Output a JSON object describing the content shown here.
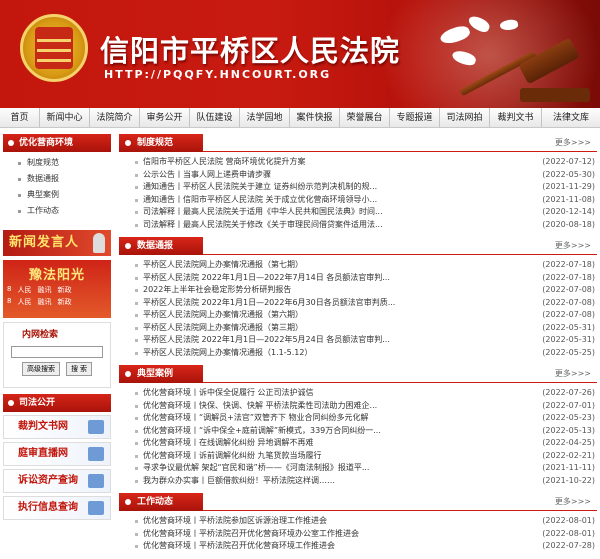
{
  "site": {
    "title": "信阳市平桥区人民法院",
    "url": "HTTP://PQQFY.HNCOURT.ORG"
  },
  "nav": [
    "首页",
    "新闻中心",
    "法院简介",
    "审务公开",
    "队伍建设",
    "法学园地",
    "案件快报",
    "荣誉展台",
    "专题报道",
    "司法网拍",
    "裁判文书",
    "法律文库"
  ],
  "sidebar": {
    "env_title": "优化营商环境",
    "env_items": [
      "制度规范",
      "数据通报",
      "典型案例",
      "工作动态"
    ],
    "ad1": "新闻发言人",
    "ad2": {
      "title": "豫法阳光",
      "row1": [
        "8",
        "人民",
        "融讯",
        "新政"
      ],
      "row2": [
        "8",
        "人民",
        "融讯",
        "新政"
      ]
    },
    "search": {
      "title": "内网检索",
      "advanced": "高级搜索",
      "submit": "搜 索"
    },
    "open_title": "司法公开",
    "quick": [
      "裁判文书网",
      "庭审直播网",
      "诉讼资产查询",
      "执行信息查询"
    ]
  },
  "sections": [
    {
      "title": "制度规范",
      "more": "更多>>>",
      "items": [
        {
          "text": "信阳市平桥区人民法院 营商环境优化提升方案",
          "date": "(2022-07-12)"
        },
        {
          "text": "公示公告丨当事人网上递费申请步骤",
          "date": "(2022-05-30)"
        },
        {
          "text": "通知通告丨平桥区人民法院关于建立 证券纠纷示范判决机制的规...",
          "date": "(2021-11-29)"
        },
        {
          "text": "通知通告丨信阳市平桥区人民法院 关于成立优化营商环境领导小...",
          "date": "(2021-11-08)"
        },
        {
          "text": "司法解释丨最高人民法院关于适用《中华人民共和国民法典》时间...",
          "date": "(2020-12-14)"
        },
        {
          "text": "司法解释丨最高人民法院关于修改《关于审理民间借贷案件适用法...",
          "date": "(2020-08-18)"
        }
      ]
    },
    {
      "title": "数据通报",
      "more": "更多>>>",
      "items": [
        {
          "text": "平桥区人民法院网上办案情况通报（第七期）",
          "date": "(2022-07-18)"
        },
        {
          "text": "平桥区人民法院 2022年1月1日—2022年7月14日 各员额法官审判...",
          "date": "(2022-07-18)"
        },
        {
          "text": "2022年上半年社会稳定形势分析研判报告",
          "date": "(2022-07-08)"
        },
        {
          "text": "平桥区人民法院 2022年1月1日—2022年6月30日各员额法官审判质...",
          "date": "(2022-07-08)"
        },
        {
          "text": "平桥区人民法院网上办案情况通报（第六期）",
          "date": "(2022-07-08)"
        },
        {
          "text": "平桥区人民法院网上办案情况通报（第三期）",
          "date": "(2022-05-31)"
        },
        {
          "text": "平桥区人民法院 2022年1月1日—2022年5月24日 各员额法官审判...",
          "date": "(2022-05-31)"
        },
        {
          "text": "平桥区人民法院网上办案情况通报（1.1-5.12）",
          "date": "(2022-05-25)"
        }
      ]
    },
    {
      "title": "典型案例",
      "more": "更多>>>",
      "items": [
        {
          "text": "优化营商环境丨诉中保全促履行 公正司法护诚信",
          "date": "(2022-07-26)"
        },
        {
          "text": "优化营商环境丨快保、快调、快解 平桥法院柔性司法助力困难企...",
          "date": "(2022-07-01)"
        },
        {
          "text": "优化营商环境丨“调解员+法官”双管齐下 物业合同纠纷多元化解",
          "date": "(2022-05-23)"
        },
        {
          "text": "优化营商环境丨“诉中保全+庭前调解”新模式，339万合同纠纷一...",
          "date": "(2022-05-13)"
        },
        {
          "text": "优化营商环境丨在线调解化纠纷 异地调解不再难",
          "date": "(2022-04-25)"
        },
        {
          "text": "优化营商环境丨诉前调解化纠纷 九笔货款当场履行",
          "date": "(2022-02-21)"
        },
        {
          "text": "寻求争议最优解 架起“官民和谐”桥——《河南法制报》报道平...",
          "date": "(2021-11-11)"
        },
        {
          "text": "我为群众办实事丨巨额借款纠纷！平桥法院这样调……",
          "date": "(2021-10-22)"
        }
      ]
    },
    {
      "title": "工作动态",
      "more": "更多>>>",
      "items": [
        {
          "text": "优化营商环境丨平桥法院参加区诉源治理工作推进会",
          "date": "(2022-08-01)"
        },
        {
          "text": "优化营商环境丨平桥法院召开优化营商环境办公室工作推进会",
          "date": "(2022-08-01)"
        },
        {
          "text": "优化营商环境丨平桥法院召开优化营商环境工作推进会",
          "date": "(2022-07-28)"
        }
      ]
    }
  ]
}
